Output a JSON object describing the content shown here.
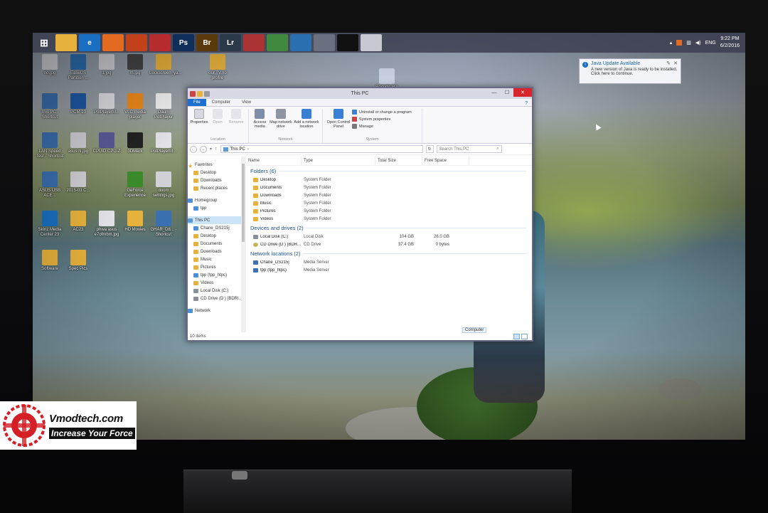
{
  "taskbar": {
    "apps": [
      {
        "name": "start",
        "label": "",
        "color": "#2a5aa8"
      },
      {
        "name": "file-explorer",
        "label": "",
        "color": "#e7b23b"
      },
      {
        "name": "internet-explorer",
        "label": "e",
        "color": "#1a6fc2"
      },
      {
        "name": "firefox",
        "label": "",
        "color": "#e26b21"
      },
      {
        "name": "app-orange",
        "label": "",
        "color": "#c2401a"
      },
      {
        "name": "chrome-red",
        "label": "",
        "color": "#b62b2b"
      },
      {
        "name": "photoshop",
        "label": "Ps",
        "color": "#0f2f5a"
      },
      {
        "name": "bridge",
        "label": "Br",
        "color": "#5a3a0a"
      },
      {
        "name": "lightroom",
        "label": "Lr",
        "color": "#2b3a4a"
      },
      {
        "name": "app-circle",
        "label": "",
        "color": "#aa3333"
      },
      {
        "name": "app-green",
        "label": "",
        "color": "#3f8a3f"
      },
      {
        "name": "app-blue",
        "label": "",
        "color": "#2a6fb0"
      },
      {
        "name": "app-photo",
        "label": "",
        "color": "#6a7080"
      },
      {
        "name": "cmd",
        "label": "",
        "color": "#111111"
      },
      {
        "name": "app-list",
        "label": "",
        "color": "#c8c8d0"
      }
    ],
    "tray": {
      "lang": "ENG",
      "time": "9:22 PM",
      "date": "6/2/2016"
    }
  },
  "desktop": {
    "icons": [
      {
        "label": "no.jpg",
        "color": "#d0d0d6"
      },
      {
        "label": "EaseUS Partition ...",
        "color": "#2a6fb0"
      },
      {
        "label": "1.jpg",
        "color": "#d0d0d6"
      },
      {
        "label": "m.jpg",
        "color": "#444"
      },
      {
        "label": "Lockscreen_ya...",
        "color": "#e7b23b"
      },
      {
        "label": "our.TV.no profile",
        "color": "#e7b23b"
      },
      {
        "label": "Recycle Bin",
        "color": "#c8d0e0"
      },
      {
        "label": "This PC - Shortcut",
        "color": "#3a6fb0"
      },
      {
        "label": "PCM 10",
        "color": "#1e5aa8"
      },
      {
        "label": "PotPlayerM...",
        "color": "#e0e0e6"
      },
      {
        "label": "VLC media player",
        "color": "#f08a1a"
      },
      {
        "label": "Daum PotPlayer",
        "color": "#f0f0f0"
      },
      {
        "label": "LAN Speed Test - Shortcut",
        "color": "#3a6fb0"
      },
      {
        "label": "asus N.jpg",
        "color": "#d0d0d6"
      },
      {
        "label": "CPUID CPU-Z",
        "color": "#5a5a9a"
      },
      {
        "label": "3DMark",
        "color": "#222"
      },
      {
        "label": "PotPlayerM...",
        "color": "#e0e0e6"
      },
      {
        "label": "ASUS USB ACE...",
        "color": "#3a6fb0"
      },
      {
        "label": "2015-03 C...",
        "color": "#d0d0d6"
      },
      {
        "label": "GeForce Experience",
        "color": "#3a8a2a"
      },
      {
        "label": "doom settings.jpg",
        "color": "#d0d0d6"
      },
      {
        "label": "Skinz Media Center 23",
        "color": "#1a6fc2"
      },
      {
        "label": "AC23",
        "color": "#e7b23b"
      },
      {
        "label": "phwa asus e7ofmbm.jpg",
        "color": "#e0e0e6"
      },
      {
        "label": "HD Movies",
        "color": "#e7b23b"
      },
      {
        "label": "GHAR_D8... - Shortcut",
        "color": "#3a6fb0"
      },
      {
        "label": "Software",
        "color": "#e7b23b"
      },
      {
        "label": "Spec Pics",
        "color": "#e7b23b"
      }
    ]
  },
  "toast": {
    "title": "Java Update Available",
    "body": "A new version of Java is ready to be installed. Click here to continue."
  },
  "explorer": {
    "title": "This PC",
    "tabs": [
      "File",
      "Computer",
      "View"
    ],
    "ribbon": {
      "location": {
        "label": "Location",
        "buttons": [
          "Properties",
          "Open",
          "Rename"
        ]
      },
      "network": {
        "label": "Network",
        "buttons": [
          "Access media",
          "Map network drive",
          "Add a network location"
        ]
      },
      "system": {
        "label": "System",
        "big": "Open Control Panel",
        "small": [
          "Uninstall or change a program",
          "System properties",
          "Manage"
        ]
      }
    },
    "address": "This PC",
    "search_placeholder": "Search This PC",
    "nav": {
      "favorites": {
        "label": "Favorites",
        "items": [
          "Desktop",
          "Downloads",
          "Recent places"
        ]
      },
      "homegroup": {
        "label": "Homegroup",
        "items": [
          "tpp"
        ]
      },
      "thispc": {
        "label": "This PC",
        "items": [
          "Chane_DS215j",
          "Desktop",
          "Documents",
          "Downloads",
          "Music",
          "Pictures",
          "tpp (tpp_htpc)",
          "Videos",
          "Local Disk (C:)",
          "CD Drive (D:) [BDRI..."
        ]
      },
      "network": {
        "label": "Network"
      }
    },
    "columns": [
      "Name",
      "Type",
      "Total Size",
      "Free Space"
    ],
    "folders_header": "Folders (6)",
    "folders": [
      {
        "name": "Desktop",
        "type": "System Folder"
      },
      {
        "name": "Documents",
        "type": "System Folder"
      },
      {
        "name": "Downloads",
        "type": "System Folder"
      },
      {
        "name": "Music",
        "type": "System Folder"
      },
      {
        "name": "Pictures",
        "type": "System Folder"
      },
      {
        "name": "Videos",
        "type": "System Folder"
      }
    ],
    "drives_header": "Devices and drives (2)",
    "drives": [
      {
        "name": "Local Disk (C:)",
        "type": "Local Disk",
        "total": "104 GB",
        "free": "26.0 GB"
      },
      {
        "name": "CD Drive (D:) [BDR...",
        "type": "CD Drive",
        "total": "37.4 GB",
        "free": "0 bytes"
      }
    ],
    "network_header": "Network locations (2)",
    "network": [
      {
        "name": "Chane_DS215j",
        "type": "Media Server"
      },
      {
        "name": "tpp (tpp_htpc)",
        "type": "Media Server"
      }
    ],
    "status": "10 items",
    "tooltip": "Computer"
  },
  "watermark": {
    "site": "Vmodtech.com",
    "slogan": "Increase Your Force"
  }
}
